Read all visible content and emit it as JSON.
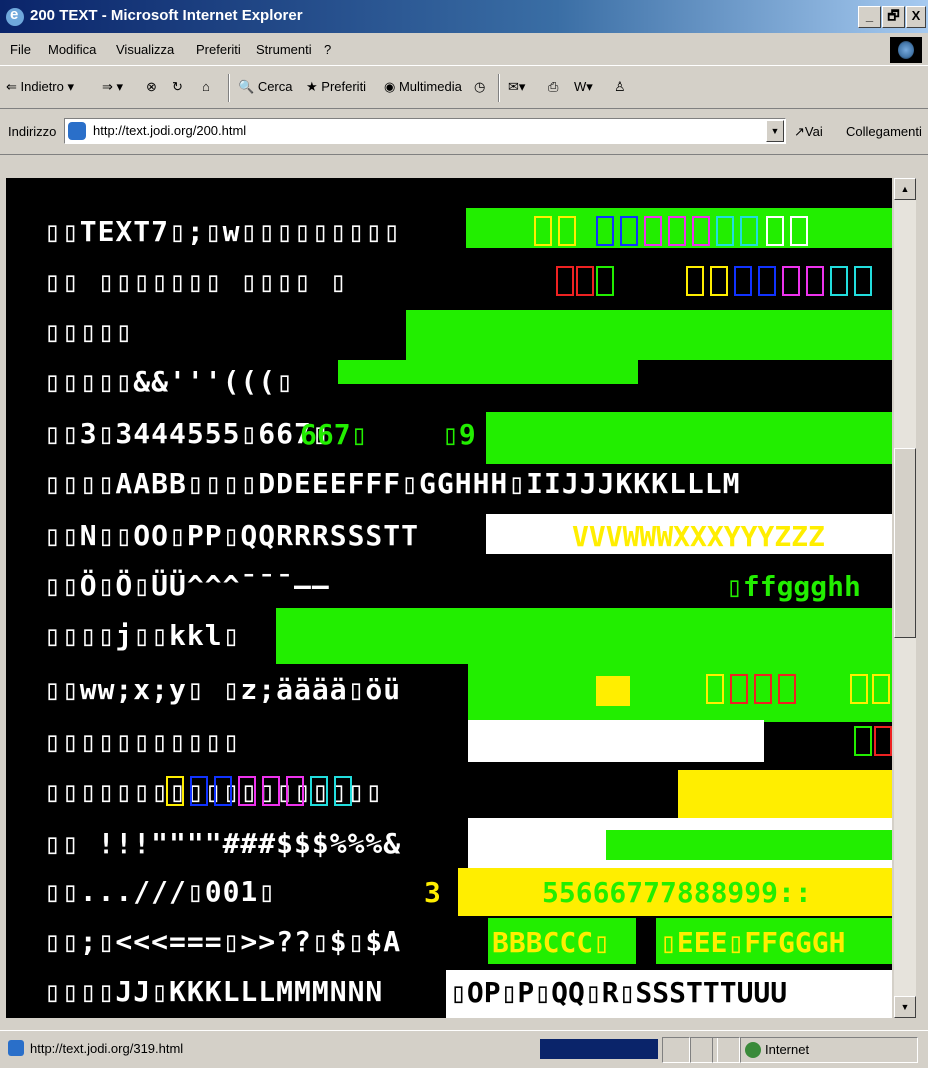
{
  "window": {
    "title": "200 TEXT - Microsoft Internet Explorer",
    "controls": [
      "_",
      "🗗",
      "X"
    ]
  },
  "menu": [
    "File",
    "Modifica",
    "Visualizza",
    "Preferiti",
    "Strumenti",
    "?"
  ],
  "toolbar": {
    "back_label": "⇐ Indietro ▾",
    "forward_label": "⇒ ▾",
    "search_label": "Cerca",
    "favorites_label": "Preferiti",
    "media_label": "Multimedia"
  },
  "address": {
    "label": "Indirizzo",
    "url": "http://text.jodi.org/200.html",
    "go_label": "Vai",
    "links_label": "Collegamenti"
  },
  "content_rows": [
    {
      "text": "▯▯TEXT7▯;▯w▯▯▯▯▯▯▯▯▯",
      "color": "#ffffff"
    },
    {
      "text": "▯▯ ▯▯▯▯▯▯▯ ▯▯▯▯ ▯",
      "color": "#ffffff"
    },
    {
      "text": "▯▯▯▯▯",
      "color": "#ffffff"
    },
    {
      "text": "▯▯▯▯▯&&'''(((▯",
      "color": "#ffffff"
    },
    {
      "text": "▯▯3▯3444555▯667▯",
      "color": "#ffffff"
    },
    {
      "text": "▯▯▯▯AABB▯▯▯▯DDEEEFFF▯GGHHH▯IIJJJKKKLLLM",
      "color": "#ffffff"
    },
    {
      "text": "▯▯N▯▯OO▯PP▯QQRRRSSSTT",
      "color": "#ffffff"
    },
    {
      "text": "▯▯Ö▯Ö▯ÜÜ^^^¯¯¯——",
      "color": "#ffffff"
    },
    {
      "text": "▯▯▯▯j▯▯kkl▯",
      "color": "#ffffff"
    },
    {
      "text": "▯▯ww;x;y▯ ▯z;ääää▯öü",
      "color": "#ffffff"
    },
    {
      "text": "▯▯▯▯▯▯▯▯▯▯▯",
      "color": "#ffffff"
    },
    {
      "text": "▯▯▯▯▯▯▯▯▯▯▯▯▯▯▯▯▯▯▯",
      "color": "#ffffff"
    },
    {
      "text": "▯▯  !!!\"\"\"\"###$$$%%%&",
      "color": "#ffffff"
    },
    {
      "text": "▯▯...///▯001▯",
      "color": "#ffffff"
    },
    {
      "text": "▯▯;▯<<<===▯>>??▯$▯$A",
      "color": "#ffffff"
    },
    {
      "text": "▯▯▯▯JJ▯KKKLLLMMMNNN",
      "color": "#ffffff"
    }
  ],
  "right_text": {
    "row6": "VVVWWWXXXYYYZZZ",
    "row8": "▯ffggghh",
    "row14": "55666777888999::",
    "row15a": "BBBCCC▯",
    "row15b": "▯EEE▯FFGGGH",
    "row16": "▯OP▯P▯QQ▯R▯SSSTTTUUU",
    "row5b": "667▯",
    "row5c": "▯9",
    "row14b": "3"
  },
  "status": {
    "url": "http://text.jodi.org/319.html",
    "zone": "Internet"
  },
  "colors": {
    "green": "#22ee00",
    "yellow": "#ffee00",
    "white": "#ffffff",
    "black": "#000000",
    "red": "#ee2222",
    "blue": "#1133ff",
    "magenta": "#ee33ee",
    "cyan": "#22dddd"
  }
}
